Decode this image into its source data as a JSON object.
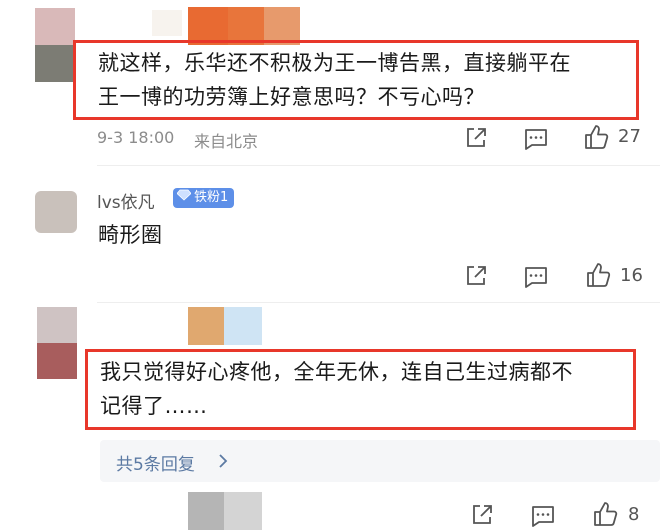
{
  "comments": [
    {
      "text_line1": "就这样，乐华还不积极为王一博告黑，直接躺平在",
      "text_line2": "王一博的功劳簿上好意思吗？不亏心吗？",
      "time": "9-3 18:00",
      "location": "来自北京",
      "likes": "27"
    },
    {
      "username": "lvs依凡",
      "badge": "铁粉1",
      "text": "畸形圈",
      "likes": "16"
    },
    {
      "text_line1": "我只觉得好心疼他，全年无休，连自己生过病都不",
      "text_line2": "记得了……",
      "replies_link": "共5条回复",
      "likes": "8"
    }
  ],
  "icons": {
    "share": "share-icon",
    "comment": "comment-icon",
    "like": "thumbs-up-icon",
    "chevron": "chevron-right-icon",
    "diamond": "diamond-icon"
  },
  "colors": {
    "highlight": "#e8372a",
    "badge": "#5d8fe8",
    "reply_link": "#5c7aa3"
  }
}
